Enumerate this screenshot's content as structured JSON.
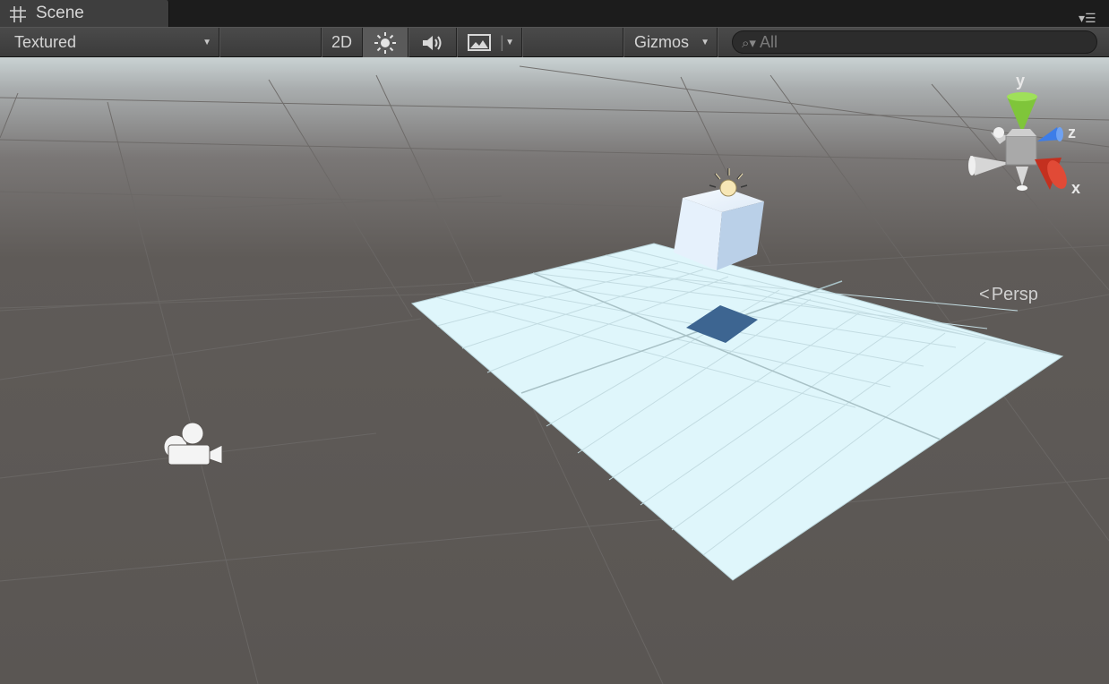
{
  "tab": {
    "title": "Scene",
    "icon": "grid-icon"
  },
  "toolbar": {
    "shading_mode": "Textured",
    "btn_2d": "2D",
    "lighting_icon": "sun-icon",
    "audio_icon": "speaker-icon",
    "effects_icon": "image-icon",
    "gizmos": "Gizmos",
    "search_placeholder": "All"
  },
  "gizmo": {
    "axis_y": "y",
    "axis_z": "z",
    "axis_x": "x",
    "projection": "Persp",
    "colors": {
      "y": "#7fc53a",
      "z": "#3d7de8",
      "x": "#d0392a"
    }
  },
  "scene_objects": [
    "camera-icon",
    "light-icon",
    "cube",
    "plane",
    "shadow"
  ],
  "colors": {
    "ground": "#5e5a57",
    "sky": "#c8d2d4",
    "plane": "#dff6fb"
  }
}
